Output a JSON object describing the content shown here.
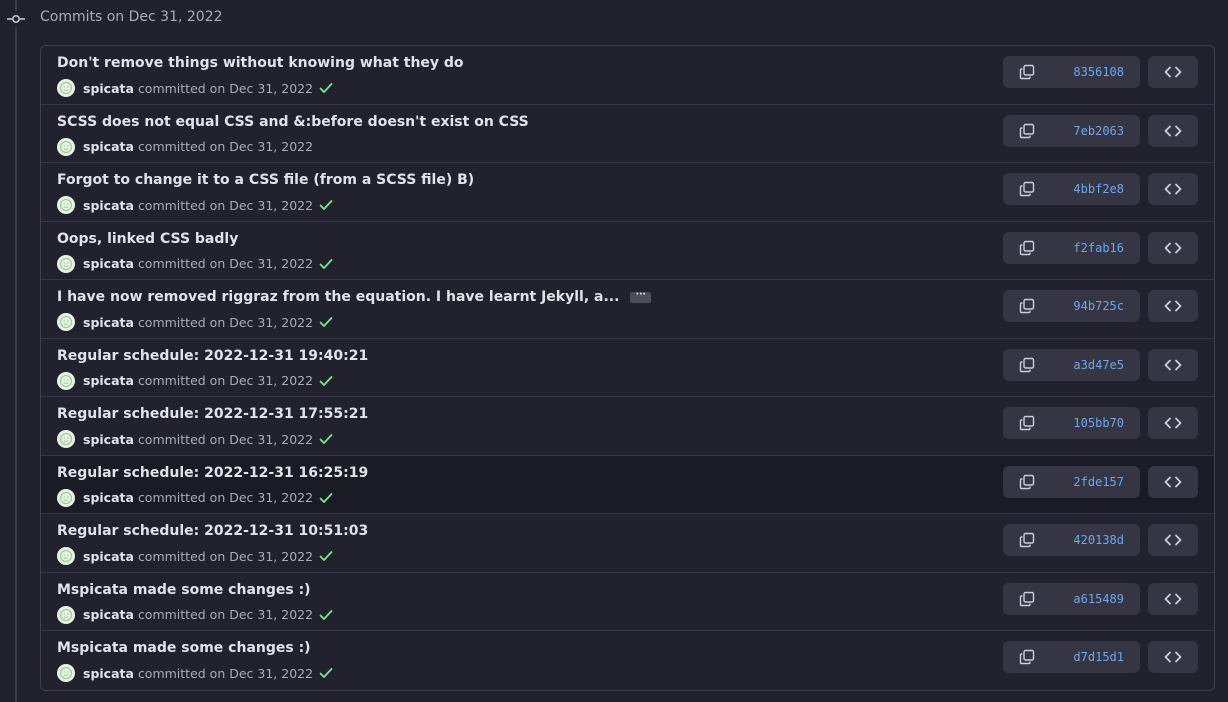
{
  "header": {
    "title": "Commits on Dec 31, 2022"
  },
  "commits": [
    {
      "title": "Don't remove things without knowing what they do",
      "author": "spicata",
      "meta": "committed on Dec 31, 2022",
      "sha": "8356108",
      "verified": true,
      "truncated": false
    },
    {
      "title": "SCSS does not equal CSS and &:before doesn't exist on CSS",
      "author": "spicata",
      "meta": "committed on Dec 31, 2022",
      "sha": "7eb2063",
      "verified": false,
      "truncated": false
    },
    {
      "title": "Forgot to change it to a CSS file (from a SCSS file) B)",
      "author": "spicata",
      "meta": "committed on Dec 31, 2022",
      "sha": "4bbf2e8",
      "verified": true,
      "truncated": false
    },
    {
      "title": "Oops, linked CSS badly",
      "author": "spicata",
      "meta": "committed on Dec 31, 2022",
      "sha": "f2fab16",
      "verified": true,
      "truncated": false
    },
    {
      "title": "I have now removed riggraz from the equation. I have learnt Jekyll, a...",
      "author": "spicata",
      "meta": "committed on Dec 31, 2022",
      "sha": "94b725c",
      "verified": true,
      "truncated": true
    },
    {
      "title": "Regular schedule: 2022-12-31 19:40:21",
      "author": "spicata",
      "meta": "committed on Dec 31, 2022",
      "sha": "a3d47e5",
      "verified": true,
      "truncated": false
    },
    {
      "title": "Regular schedule: 2022-12-31 17:55:21",
      "author": "spicata",
      "meta": "committed on Dec 31, 2022",
      "sha": "105bb70",
      "verified": true,
      "truncated": false
    },
    {
      "title": "Regular schedule: 2022-12-31 16:25:19",
      "author": "spicata",
      "meta": "committed on Dec 31, 2022",
      "sha": "2fde157",
      "verified": true,
      "truncated": false
    },
    {
      "title": "Regular schedule: 2022-12-31 10:51:03",
      "author": "spicata",
      "meta": "committed on Dec 31, 2022",
      "sha": "420138d",
      "verified": true,
      "truncated": false
    },
    {
      "title": "Mspicata made some changes :)",
      "author": "spicata",
      "meta": "committed on Dec 31, 2022",
      "sha": "a615489",
      "verified": true,
      "truncated": false
    },
    {
      "title": "Mspicata made some changes :)",
      "author": "spicata",
      "meta": "committed on Dec 31, 2022",
      "sha": "d7d15d1",
      "verified": true,
      "truncated": false
    }
  ],
  "highlighted_row": 7,
  "icons": {
    "timeline": "git-commit-icon",
    "copy": "copy-icon",
    "browse": "code-icon",
    "verified": "check-icon",
    "ellipsis": "ellipsis-icon"
  },
  "colors": {
    "background": "#22222f",
    "sha_link": "#6aa7f0",
    "check": "#7ee787",
    "button_bg": "#353544"
  }
}
